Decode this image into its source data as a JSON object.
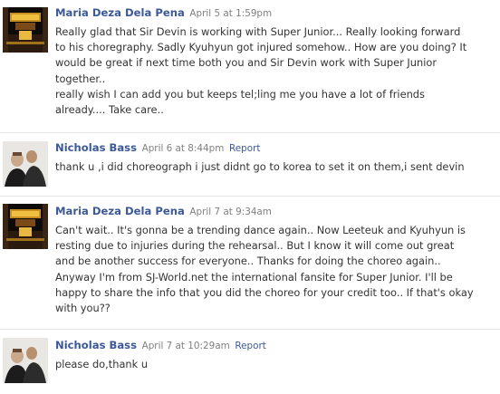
{
  "comments": [
    {
      "author": "Maria Deza Dela Pena",
      "time": "April 5 at 1:59pm",
      "report": "",
      "text": "Really glad that Sir Devin is working with Super Junior... Really looking forward\nto his choregraphy. Sadly Kyuhyun got injured somehow.. How are you doing? It\nwould be great if next time both you and Sir Devin work with Super Junior\ntogether..\nreally wish I can add you but keeps tel;ling me you have a lot of friends\nalready.... Take care.."
    },
    {
      "author": "Nicholas Bass",
      "time": "April 6 at 8:44pm",
      "report": "Report",
      "text": "thank u ,i did choreograph i just didnt go to korea to set it on them,i sent devin"
    },
    {
      "author": "Maria Deza Dela Pena",
      "time": "April 7 at 9:34am",
      "report": "",
      "text": "Can't wait.. It's gonna be a trending dance again.. Now Leeteuk and Kyuhyun is\nresting due to injuries during the rehearsal.. But I know it will come out great\nand be another success for everyone.. Thanks for doing the choreo again..\nAnyway I'm from SJ-World.net the international fansite for Super Junior. I'll be\nhappy to share the info that you did the choreo for your credit too.. If that's okay\nwith you??"
    },
    {
      "author": "Nicholas Bass",
      "time": "April 7 at 10:29am",
      "report": "Report",
      "text": "please do,thank u"
    }
  ],
  "colors": {
    "link": "#3b5998",
    "timestamp": "#808080",
    "text": "#333333",
    "divider": "#e6e6e6"
  }
}
